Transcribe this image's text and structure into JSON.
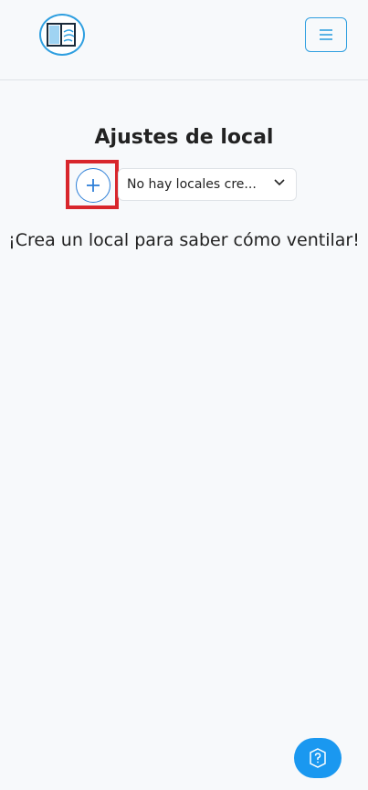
{
  "header": {
    "logo_icon": "window-airflow-logo-icon",
    "menu_icon": "hamburger-menu-icon"
  },
  "main": {
    "title": "Ajustes de local",
    "add_icon": "plus-icon",
    "select": {
      "value": "No hay locales cre...",
      "chevron_icon": "chevron-down-icon"
    },
    "empty_message": "¡Crea un local para saber cómo ventilar!"
  },
  "help": {
    "icon": "help-question-icon"
  },
  "colors": {
    "accent": "#2f9fe0",
    "help_button": "#1a98f0",
    "highlight": "#d8262c",
    "background": "#f7f9fb"
  }
}
